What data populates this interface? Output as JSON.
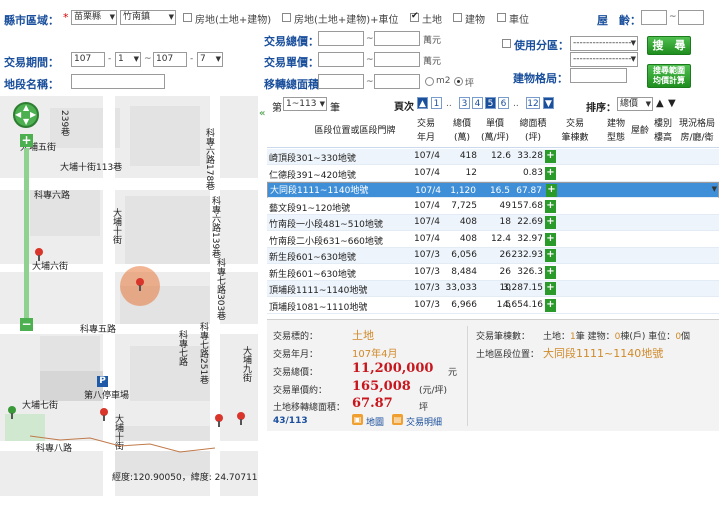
{
  "filters": {
    "county_label": "縣市區域：",
    "county_value": "苗栗縣",
    "town_value": "竹南鎮",
    "type_options": [
      {
        "label": "房地(土地+建物)",
        "checked": false
      },
      {
        "label": "房地(土地+建物)+車位",
        "checked": false
      },
      {
        "label": "土地",
        "checked": true
      },
      {
        "label": "建物",
        "checked": false
      },
      {
        "label": "車位",
        "checked": false
      }
    ],
    "age_label": "屋　齡：",
    "age_sep": "~",
    "total_price_label": "交易總價：",
    "total_price_unit": "萬元",
    "unit_price_label": "交易單價：",
    "unit_price_unit": "萬元",
    "area_label": "移轉總面積：",
    "area_unit_m2": "m2",
    "area_unit_ping": "坪",
    "range_sep": "~",
    "use_zone_label": "使用分區：",
    "use_zone_value": "------------------",
    "use_zone_value2": "------------------",
    "period_label": "交易期間：",
    "period_from_year": "107",
    "period_from_month": "1",
    "period_to_year": "107",
    "period_to_month": "7",
    "period_dash": "-",
    "period_tilde": "~",
    "landmark_label": "地段名稱：",
    "layout_label": "建物格局：",
    "search_button": "搜　尋",
    "calc_button_line1": "搜尋範圍",
    "calc_button_line2": "均價計算"
  },
  "map": {
    "roads": [
      "科專六路",
      "科專五路",
      "大埔五街",
      "大埔十街113巷",
      "大埔十街",
      "大埔六街",
      "科專六路178巷",
      "科專六路139巷",
      "科專七路303巷",
      "科專七路251巷",
      "科專七路",
      "科專八路",
      "大埔七街",
      "大埔九街",
      "大埔十街",
      "科專五路",
      "239巷"
    ],
    "label_parking": "第八停車場",
    "parking_icon": "P",
    "coords_text": "經度:120.90050，緯度: 24.70711"
  },
  "list": {
    "page_prefix": "第",
    "page_value": "1~113",
    "page_suffix": "筆",
    "pages_label": "頁次",
    "pages": [
      "1",
      "..",
      "3",
      "4",
      "5",
      "6",
      "..",
      "12"
    ],
    "current_page": "5",
    "sort_label": "排序：",
    "sort_value": "總價",
    "headers": {
      "location": "區段位置或區段門牌",
      "trade_ym_1": "交易",
      "trade_ym_2": "年月",
      "total_1": "總價",
      "total_2": "(萬)",
      "unit_1": "單價",
      "unit_2": "(萬/坪)",
      "area_1": "總面積",
      "area_2": "(坪)",
      "count_1": "交易",
      "count_2": "筆棟數",
      "btype_1": "建物",
      "btype_2": "型態",
      "floors": "屋齡",
      "height_1": "樓別",
      "height_2": "樓高",
      "layout_1": "現況格局",
      "layout_2": "房/廳/衛"
    },
    "rows": [
      {
        "loc": "崎頂段301~330地號",
        "ym": "107/4",
        "total": "418",
        "unit": "12.6",
        "area": "33.28"
      },
      {
        "loc": "仁德段391~420地號",
        "ym": "107/4",
        "total": "12",
        "unit": "",
        "area": "0.83"
      },
      {
        "loc": "大同段1111~1140地號",
        "ym": "107/4",
        "total": "1,120",
        "unit": "16.5",
        "area": "67.87"
      },
      {
        "loc": "藝文段91~120地號",
        "ym": "107/4",
        "total": "7,725",
        "unit": "49",
        "area": "157.68"
      },
      {
        "loc": "竹南段一小段481~510地號",
        "ym": "107/4",
        "total": "408",
        "unit": "18",
        "area": "22.69"
      },
      {
        "loc": "竹南段二小段631~660地號",
        "ym": "107/4",
        "total": "408",
        "unit": "12.4",
        "area": "32.97"
      },
      {
        "loc": "新生段601~630地號",
        "ym": "107/3",
        "total": "6,056",
        "unit": "26",
        "area": "232.93"
      },
      {
        "loc": "新生段601~630地號",
        "ym": "107/3",
        "total": "8,484",
        "unit": "26",
        "area": "326.3"
      },
      {
        "loc": "頂埔段1111~1140地號",
        "ym": "107/3",
        "total": "33,033",
        "unit": "10",
        "area": "3,287.15"
      },
      {
        "loc": "頂埔段1081~1110地號",
        "ym": "107/3",
        "total": "6,966",
        "unit": "1.5",
        "area": "4,654.16"
      }
    ],
    "selected_row": 2,
    "plus_glyph": "+"
  },
  "detail": {
    "type_label": "交易標的：",
    "type_value": "土地",
    "ym_label": "交易年月：",
    "ym_value": "107年4月",
    "total_label": "交易總價：",
    "total_value": "11,200,000",
    "total_unit": "元",
    "unit_label": "交易單價約：",
    "unit_value": "165,008",
    "unit_unit": "(元/坪)",
    "area_label": "土地移轉總面積：",
    "area_value": "67.87",
    "area_unit": "坪",
    "counter": "43/113",
    "map_link": "地圖",
    "detail_link": "交易明細",
    "count_label": "交易筆棟數：",
    "count_value_land_label": "土地：",
    "count_value_land": "1",
    "count_value_land_unit": "筆",
    "count_value_bld_label": "建物：",
    "count_value_bld": "0",
    "count_value_bld_unit": "棟(戶)",
    "count_value_park_label": "車位：",
    "count_value_park": "0",
    "count_value_park_unit": "個",
    "pos_label": "土地區段位置：",
    "pos_value": "大同段1111~1140地號"
  }
}
